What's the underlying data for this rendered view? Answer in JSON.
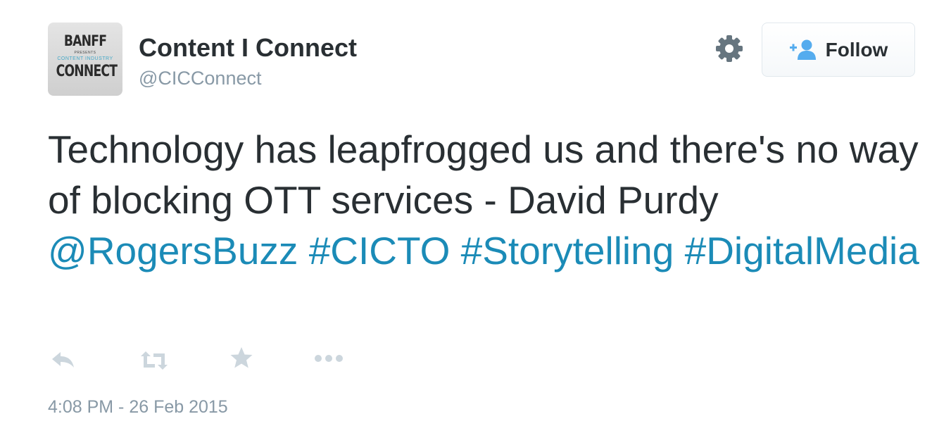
{
  "account": {
    "avatar": {
      "line1": "BANFF",
      "line2": "PRESENTS",
      "line3": "CONTENT INDUSTRY",
      "line4": "CONNECT"
    },
    "display_name": "Content I Connect",
    "handle": "@CICConnect"
  },
  "header": {
    "settings_icon": "gear-icon",
    "follow_label": "Follow",
    "follow_icon": "add-user-icon"
  },
  "tweet": {
    "text_plain": "Technology has leapfrogged us and there's no way of blocking OTT services - David Purdy ",
    "mention": "@RogersBuzz",
    "hashtags": [
      "#CICTO",
      "#Storytelling",
      "#DigitalMedia"
    ],
    "timestamp": "4:08 PM - 26 Feb 2015"
  },
  "actions": [
    {
      "name": "reply",
      "icon": "reply-icon"
    },
    {
      "name": "retweet",
      "icon": "retweet-icon"
    },
    {
      "name": "favorite",
      "icon": "star-icon"
    },
    {
      "name": "more",
      "icon": "more-icon"
    }
  ],
  "colors": {
    "link": "#1b8bb7",
    "text": "#292f33",
    "muted": "#8899a6",
    "icon": "#ccd6dd",
    "follow_icon": "#55acee"
  }
}
